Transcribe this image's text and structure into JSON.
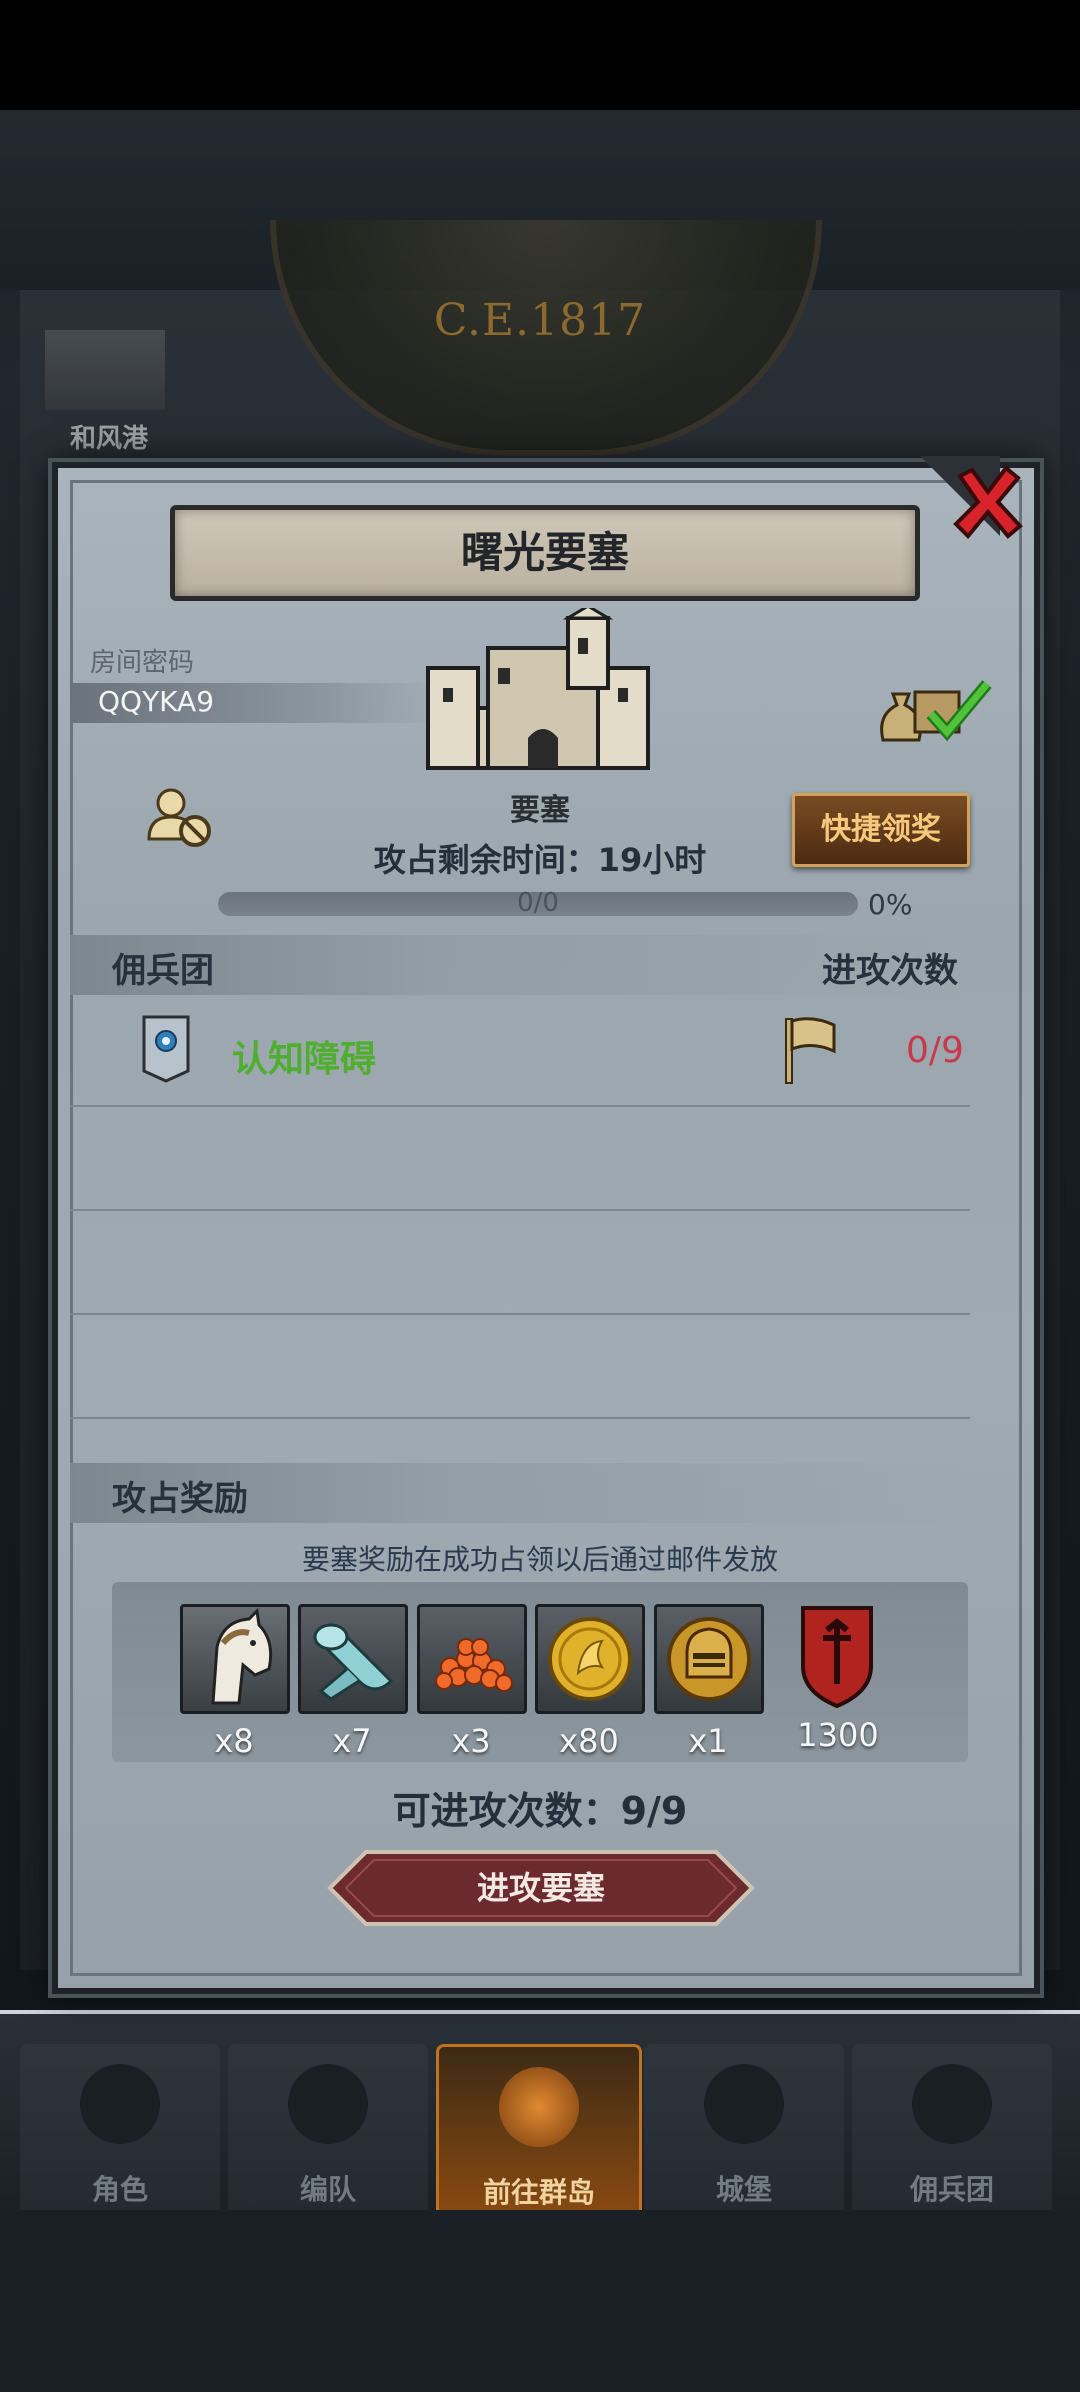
{
  "background": {
    "era": "C.E.1817",
    "location_label": "和风港"
  },
  "modal": {
    "title": "曙光要塞",
    "room_password_label": "房间密码",
    "room_password": "QQYKA9",
    "building_label": "要塞",
    "remaining_time": "攻占剩余时间：19小时",
    "quick_claim_label": "快捷领奖",
    "progress": {
      "text": "0/0",
      "percent_text": "0%",
      "fraction": 0
    },
    "mercenary_section": {
      "title": "佣兵团",
      "count_header": "进攻次数",
      "teams": [
        {
          "name": "认知障碍",
          "attacks": "0/9",
          "name_color": "#4fae2e",
          "count_color": "#c8384a"
        }
      ]
    },
    "reward_section": {
      "title": "攻占奖励",
      "note": "要塞奖励在成功占领以后通过邮件发放",
      "items": [
        {
          "icon": "horse-icon",
          "count": "x8"
        },
        {
          "icon": "cloth-roll-icon",
          "count": "x7"
        },
        {
          "icon": "fish-roe-icon",
          "count": "x3"
        },
        {
          "icon": "gold-coin-icon",
          "count": "x80"
        },
        {
          "icon": "knight-helmet-coin-icon",
          "count": "x1"
        },
        {
          "icon": "red-shield-icon",
          "count": "1300"
        }
      ]
    },
    "attempts_text": "可进攻次数：9/9",
    "attack_button_label": "进攻要塞"
  },
  "bottom_nav": {
    "items": [
      {
        "label": "角色",
        "icon": "knight-icon"
      },
      {
        "label": "编队",
        "icon": "helmet-icon"
      },
      {
        "label": "前往群岛",
        "icon": "compass-icon",
        "active": true
      },
      {
        "label": "城堡",
        "icon": "castle-icon"
      },
      {
        "label": "佣兵团",
        "icon": "banner-icon"
      }
    ]
  },
  "colors": {
    "modal_bg": "#a0aab2",
    "green_name": "#4fae2e",
    "red_count": "#c8384a",
    "gold_button": "#f6c87b",
    "attack_button": "#6a2a2e"
  }
}
